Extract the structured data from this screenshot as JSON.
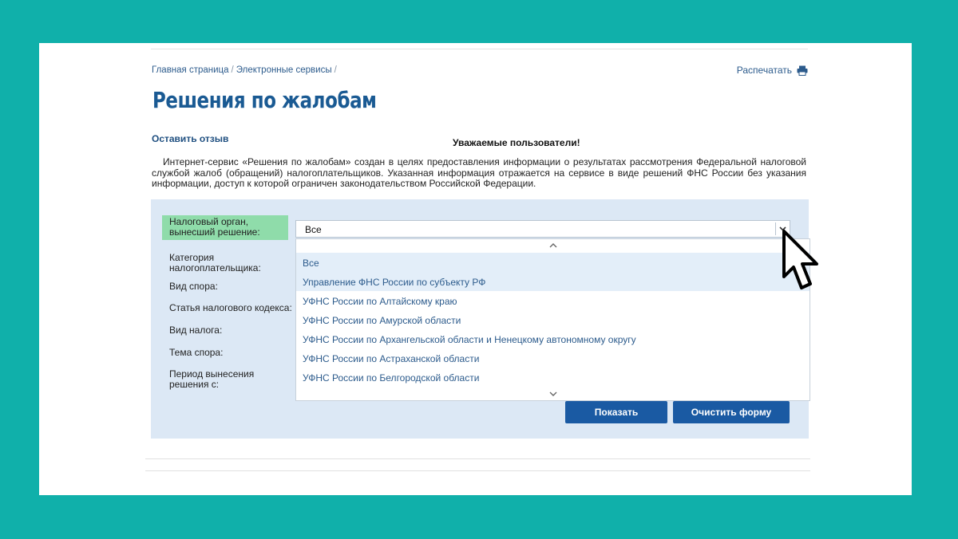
{
  "breadcrumb": {
    "items": [
      "Главная страница",
      "Электронные сервисы"
    ],
    "separator": "/"
  },
  "print_label": "Распечатать",
  "page_title": "Решения по жалобам",
  "feedback_link": "Оставить отзыв",
  "notice": {
    "title": "Уважаемые пользователи!",
    "text": "Интернет-сервис «Решения по жалобам» создан в целях предоставления информации о результатах рассмотрения Федеральной налоговой службой жалоб (обращений) налогоплательщиков. Указанная информация отражается на сервисе в виде решений ФНС России без указания информации, доступ к которой ограничен законодательством Российской Федерации."
  },
  "form": {
    "labels": {
      "tax_authority": "Налоговый орган, вынесший решение:",
      "category": "Категория налогоплательщика:",
      "dispute_type": "Вид спора:",
      "tax_code_article": "Статья налогового кодекса:",
      "tax_type": "Вид налога:",
      "dispute_topic": "Тема спора:",
      "period_from": "Период вынесения решения с:"
    },
    "tax_authority_value": "Все",
    "dropdown_options": [
      "Все",
      "Управление ФНС России по субъекту РФ",
      "УФНС России по Алтайскому краю",
      "УФНС России по Амурской области",
      "УФНС России по Архангельской области и Ненецкому автономному округу",
      "УФНС России по Астраханской области",
      "УФНС России по Белгородской области"
    ],
    "highlighted_options": [
      0,
      1
    ],
    "show_button": "Показать",
    "clear_button": "Очистить форму"
  },
  "colors": {
    "background": "#10b0aa",
    "accent": "#1a5aa3",
    "title": "#1a5a93",
    "active_label": "#8fdcaa",
    "form_bg": "#dce8f5"
  },
  "icons": {
    "print": "printer-icon",
    "caret": "chevron-down-icon",
    "scroll_up": "chevron-up-icon",
    "scroll_down": "chevron-down-icon",
    "pointer": "mouse-cursor-icon"
  }
}
